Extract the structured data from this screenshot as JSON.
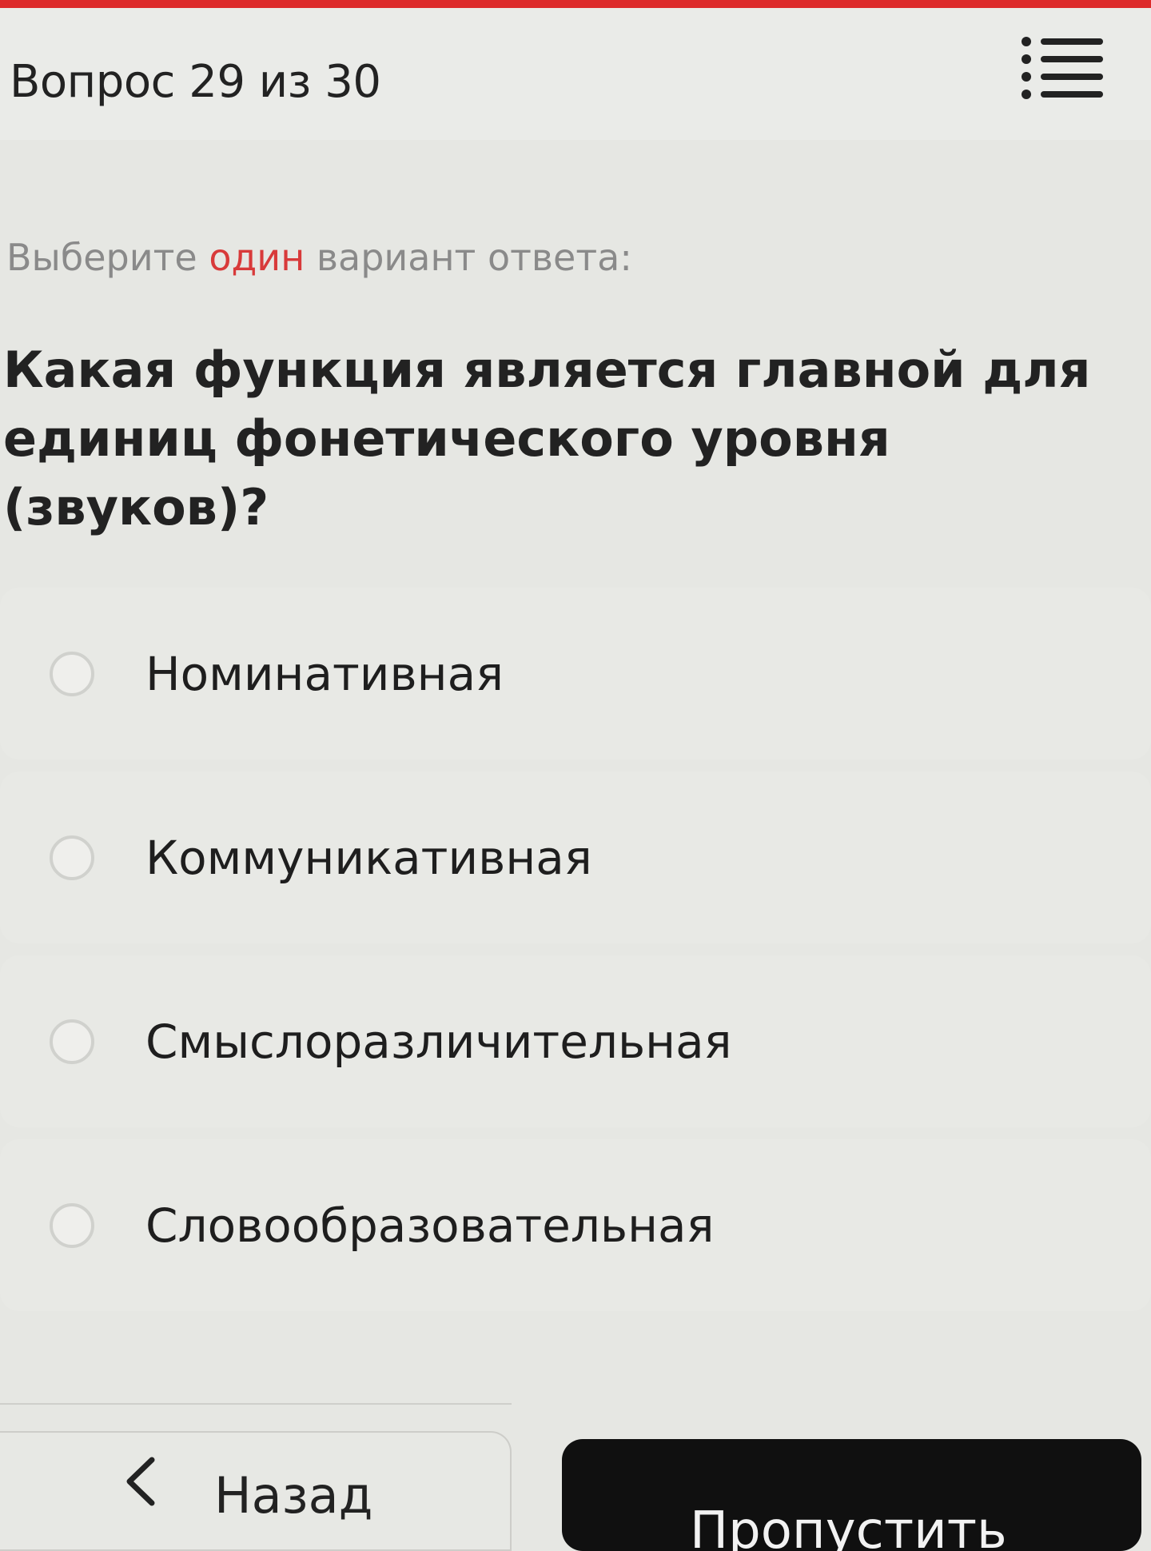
{
  "header": {
    "question_counter": "Вопрос 29 из 30",
    "menu_icon": "list-icon"
  },
  "instruction": {
    "before": "Выберите ",
    "highlight": "один",
    "after": " вариант ответа:"
  },
  "question": {
    "text": "Какая функция является главной для единиц фонетического уровня (звуков)?"
  },
  "options": [
    {
      "label": "Номинативная",
      "selected": false
    },
    {
      "label": "Коммуникативная",
      "selected": false
    },
    {
      "label": "Смыслоразличительная",
      "selected": false
    },
    {
      "label": "Словообразовательная",
      "selected": false
    }
  ],
  "footer": {
    "back_label": "Назад",
    "back_icon": "chevron-left-icon",
    "skip_label": "Пропустить"
  },
  "colors": {
    "accent_red": "#dd2b2b",
    "instruction_gray": "#8a8a8a",
    "skip_button_bg": "#101010"
  }
}
